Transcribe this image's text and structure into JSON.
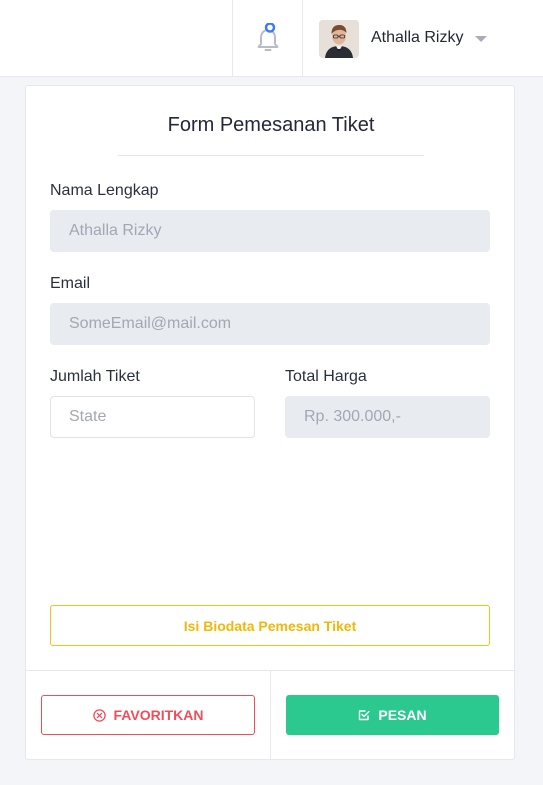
{
  "header": {
    "user_name": "Athalla Rizky",
    "notification_icon": "bell-icon",
    "dropdown_icon": "caret-down-icon"
  },
  "form": {
    "title": "Form Pemesanan Tiket",
    "nama_label": "Nama Lengkap",
    "nama_value": "Athalla Rizky",
    "email_label": "Email",
    "email_value": "SomeEmail@mail.com",
    "jumlah_label": "Jumlah Tiket",
    "jumlah_placeholder": "State",
    "total_label": "Total Harga",
    "total_value": "Rp. 300.000,-",
    "info_text": "Isi Biodata Pemesan Tiket"
  },
  "actions": {
    "favorite_label": "FAVORITKAN",
    "order_label": "PESAN"
  },
  "colors": {
    "accent_green": "#2bc88f",
    "danger_red": "#ef4d5b",
    "warning_yellow": "#f5c21b",
    "notification_dot": "#3b7cf6"
  }
}
